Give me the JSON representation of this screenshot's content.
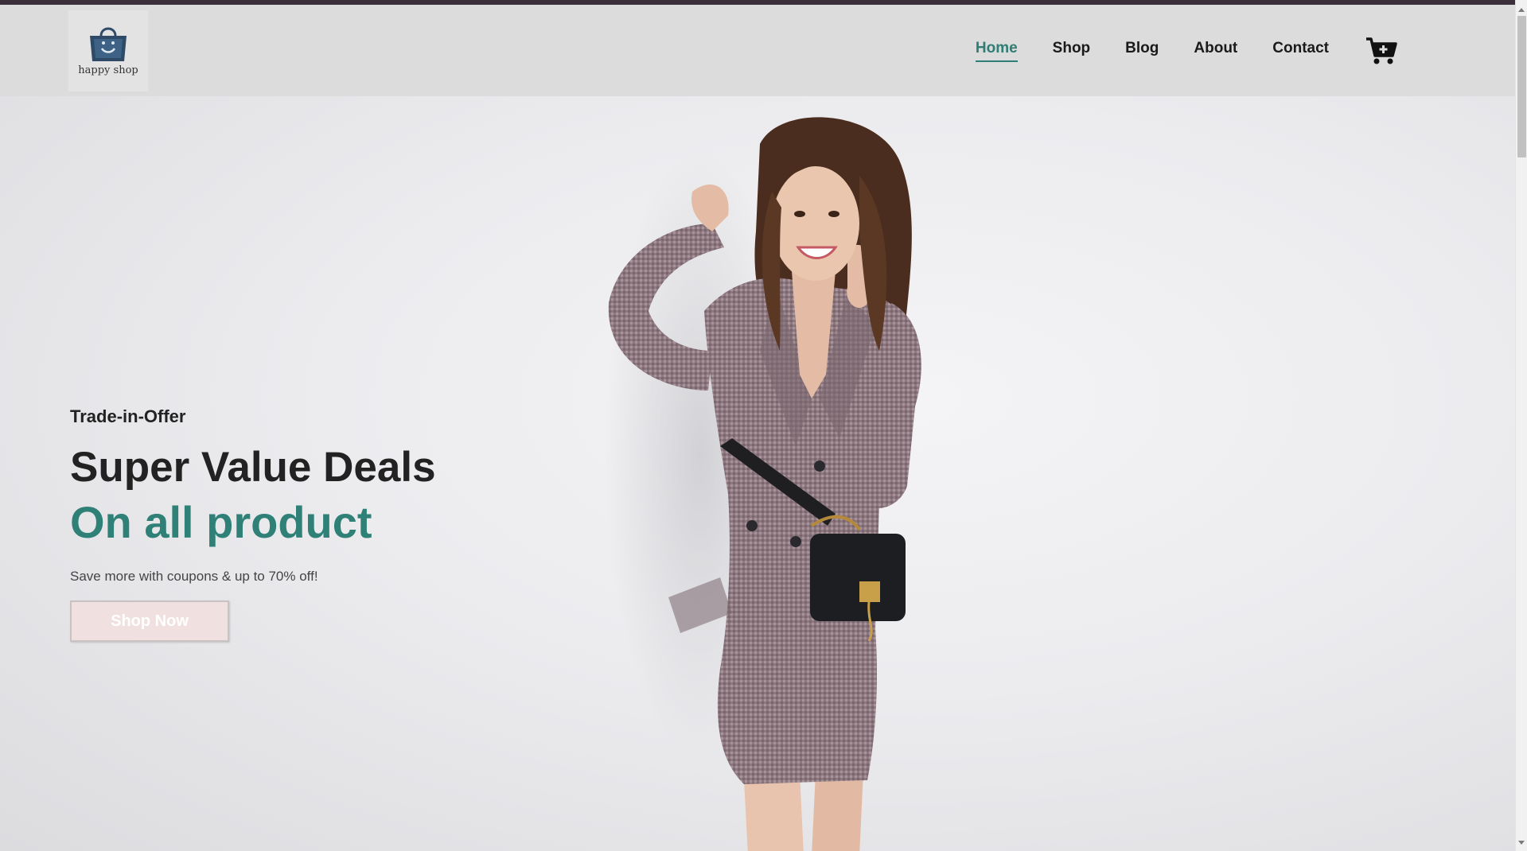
{
  "brand": {
    "name": "happy shop",
    "icon": "shopping-bag-logo"
  },
  "nav": {
    "items": [
      {
        "label": "Home",
        "active": true
      },
      {
        "label": "Shop",
        "active": false
      },
      {
        "label": "Blog",
        "active": false
      },
      {
        "label": "About",
        "active": false
      },
      {
        "label": "Contact",
        "active": false
      }
    ],
    "cart_icon": "cart-plus-icon"
  },
  "hero": {
    "eyebrow": "Trade-in-Offer",
    "headline": "Super Value Deals",
    "headline_accent": "On all product",
    "subtext": "Save more with coupons & up to 70% off!",
    "cta_label": "Shop Now",
    "image": "model-in-checked-blazer-dress-with-black-bag"
  },
  "colors": {
    "accent": "#2f7d75",
    "topbar": "#3b2f3a",
    "header_bg": "#dcdcdc",
    "cta_bg": "#f1e0e0"
  }
}
